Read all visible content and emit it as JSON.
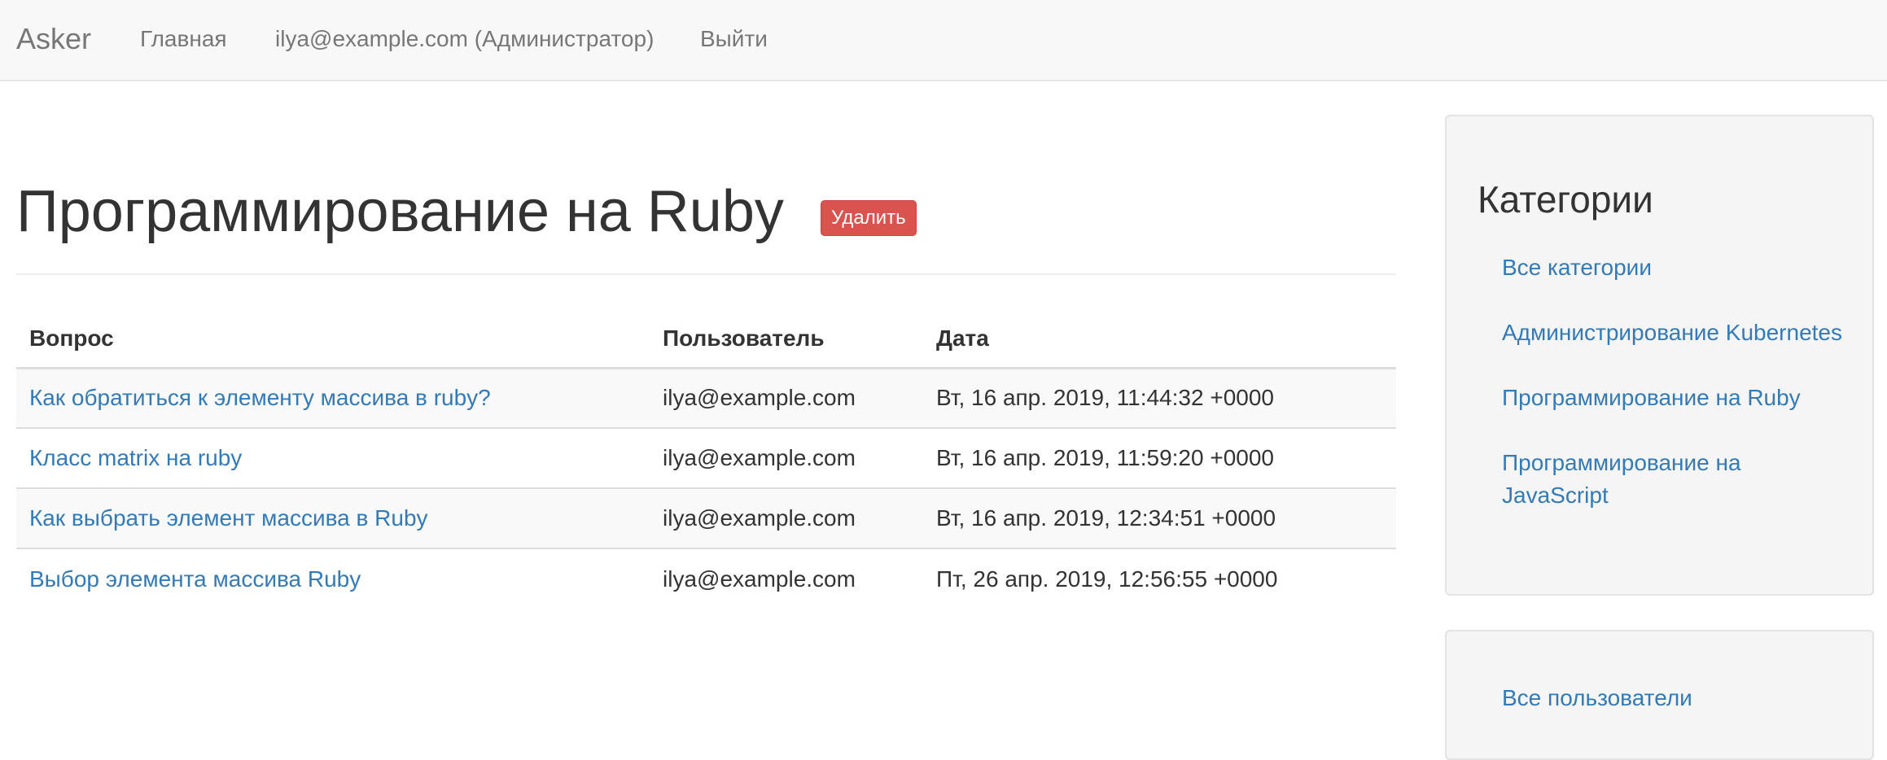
{
  "navbar": {
    "brand": "Asker",
    "home": "Главная",
    "user": "ilya@example.com (Администратор)",
    "logout": "Выйти"
  },
  "page": {
    "title": "Программирование на Ruby",
    "delete_label": "Удалить"
  },
  "table": {
    "headers": {
      "question": "Вопрос",
      "user": "Пользователь",
      "date": "Дата"
    },
    "rows": [
      {
        "question": "Как обратиться к элементу массива в ruby?",
        "user": "ilya@example.com",
        "date": "Вт, 16 апр. 2019, 11:44:32 +0000"
      },
      {
        "question": "Класс matrix на ruby",
        "user": "ilya@example.com",
        "date": "Вт, 16 апр. 2019, 11:59:20 +0000"
      },
      {
        "question": "Как выбрать элемент массива в Ruby",
        "user": "ilya@example.com",
        "date": "Вт, 16 апр. 2019, 12:34:51 +0000"
      },
      {
        "question": "Выбор элемента массива Ruby",
        "user": "ilya@example.com",
        "date": "Пт, 26 апр. 2019, 12:56:55 +0000"
      }
    ]
  },
  "sidebar": {
    "categories_title": "Категории",
    "categories": [
      "Все категории",
      "Администрирование Kubernetes",
      "Программирование на Ruby",
      "Программирование на JavaScript"
    ],
    "users_link": "Все пользователи"
  },
  "colors": {
    "link": "#337ab7",
    "danger": "#d9534f",
    "navbar_bg": "#f8f8f8",
    "well_bg": "#f5f5f5"
  }
}
